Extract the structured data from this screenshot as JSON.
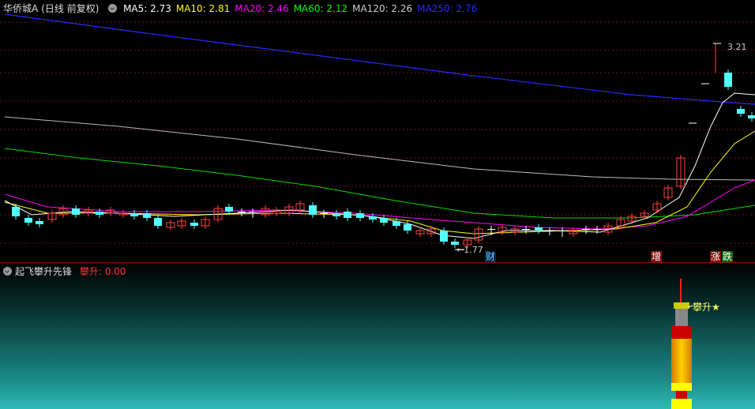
{
  "main": {
    "stock_name": "华侨城A",
    "period_label": "(日线 前复权)",
    "ma": [
      {
        "label": "MA5:",
        "value": "2.73",
        "color": "#ffffff"
      },
      {
        "label": "MA10:",
        "value": "2.81",
        "color": "#ffff00"
      },
      {
        "label": "MA20:",
        "value": "2.46",
        "color": "#ff00ff"
      },
      {
        "label": "MA60:",
        "value": "2.12",
        "color": "#00ff00"
      },
      {
        "label": "MA120:",
        "value": "2.26",
        "color": "#cccccc"
      },
      {
        "label": "MA250:",
        "value": "2.76",
        "color": "#2a2aff"
      }
    ],
    "high_label": "3.21",
    "low_label": "1.77",
    "tags": {
      "cai": "财",
      "zeng": "增",
      "zhang": "涨",
      "die": "跌"
    }
  },
  "sub": {
    "indicator_name": "起飞攀升先锋",
    "value_label": "攀升:",
    "value": "0.00",
    "signal_label": "攀升★"
  },
  "chart_data": {
    "type": "candlestick",
    "high_marker": 3.21,
    "low_marker": 1.77,
    "ma_values": {
      "MA5": 2.73,
      "MA10": 2.81,
      "MA20": 2.46,
      "MA60": 2.12,
      "MA120": 2.26,
      "MA250": 2.76
    }
  }
}
